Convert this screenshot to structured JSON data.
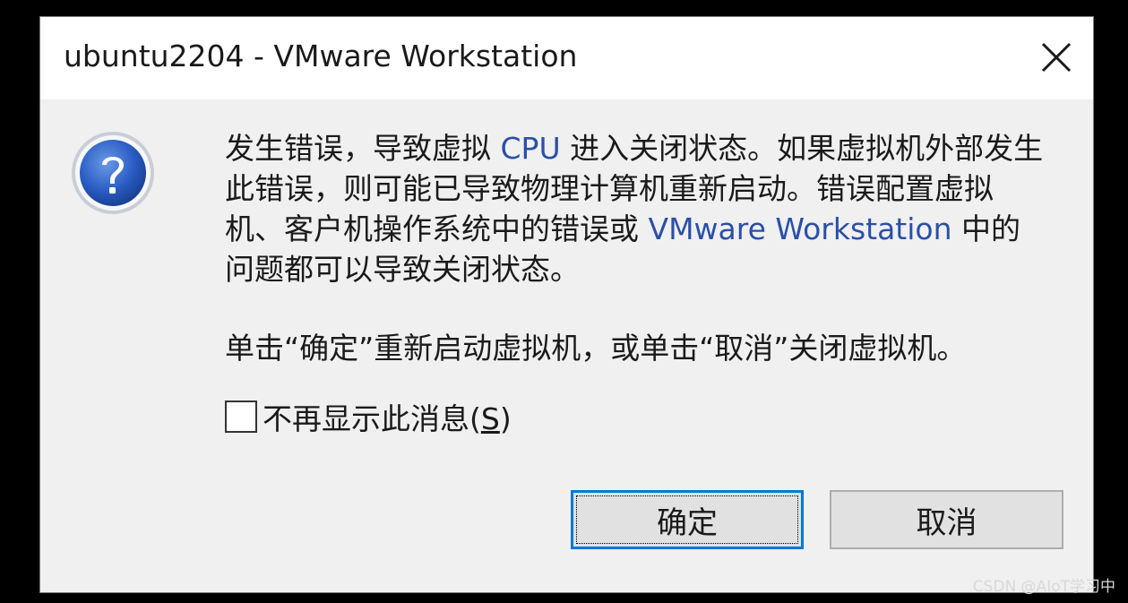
{
  "window": {
    "title": "ubuntu2204 - VMware Workstation"
  },
  "icons": {
    "dialog_icon": "question-icon",
    "close": "close-icon"
  },
  "message": {
    "part1": "发生错误，导致虚拟 ",
    "part2": "CPU",
    "part3": " 进入关闭状态。如果虚拟机外部发生此错误，则可能已导致物理计算机重新启动。错误配置虚拟机、客户机操作系统中的错误或 ",
    "part4": "VMware Workstation",
    "part5": " 中的问题都可以导致关闭状态。"
  },
  "instruction": "单击“确定”重新启动虚拟机，或单击“取消”关闭虚拟机。",
  "checkbox": {
    "label_prefix": "不再显示此消息(",
    "label_accel": "S",
    "label_suffix": ")",
    "checked": false
  },
  "buttons": {
    "ok": "确定",
    "cancel": "取消"
  },
  "watermark": "CSDN @AIoT学习中",
  "colors": {
    "accent": "#0078d7",
    "dialog_bg": "#f0f0f0",
    "titlebar_bg": "#ffffff",
    "link_text": "#2b4fa8"
  }
}
